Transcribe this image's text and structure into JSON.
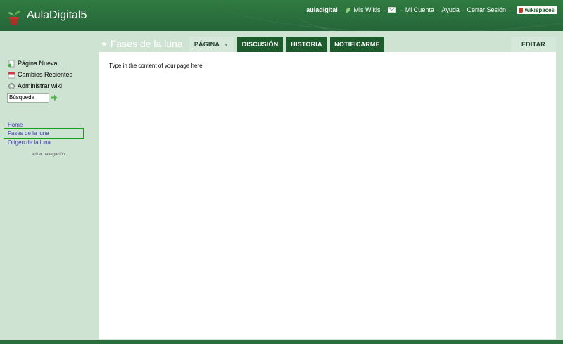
{
  "site": {
    "title": "AulaDigital5"
  },
  "topnav": {
    "user": "auladigital",
    "my_wikis": "Mis Wikis",
    "my_account": "Mi Cuenta",
    "help": "Ayuda",
    "logout": "Cerrar Sesión",
    "brand": "wikispaces",
    "separator": "·"
  },
  "page": {
    "title": "Fases de la luna",
    "body": "Type in the content of your page here."
  },
  "tabs": {
    "page": "PÁGINA",
    "discussion": "DISCUSIÓN",
    "history": "HISTORIA",
    "notify": "NOTIFICARME",
    "edit": "EDITAR"
  },
  "sidebar": {
    "new_page": "Página Nueva",
    "recent_changes": "Cambios Recientes",
    "manage_wiki": "Administrar wiki",
    "search_value": "Búsqueda",
    "nav": [
      "Home",
      "Fases de la luna",
      "Origen de la luna"
    ],
    "edit_nav": "editar navegación"
  },
  "icons": {
    "logo": "plant-pot-icon",
    "my_wikis": "leaf-icon",
    "messages": "envelope-icon",
    "new_page": "new-page-icon",
    "recent_changes": "calendar-icon",
    "manage_wiki": "gear-icon",
    "search_go": "arrow-right-icon",
    "tab_caret": "caret-down-icon",
    "star": "star-icon"
  },
  "colors": {
    "header_green": "#2f7b40",
    "tab_dark": "#1d5a2c",
    "tab_light": "#d6e8d9",
    "sidebar_bg": "#cfe3d3",
    "link": "#3b3bb0",
    "current_nav_border": "#1aa01a"
  }
}
